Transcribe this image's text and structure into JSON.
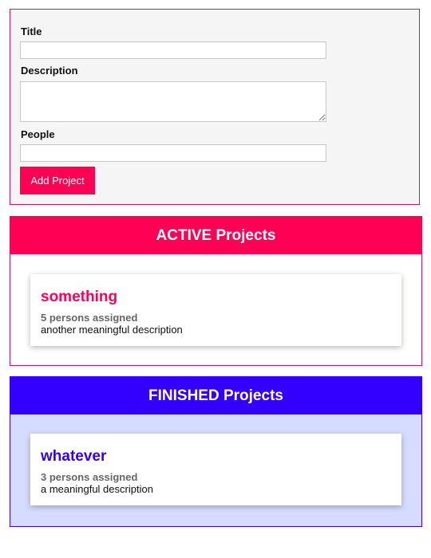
{
  "form": {
    "title_label": "Title",
    "title_value": "",
    "description_label": "Description",
    "description_value": "",
    "people_label": "People",
    "people_value": "",
    "submit_label": "Add Project"
  },
  "active": {
    "heading": "ACTIVE Projects",
    "color": "#ff0055",
    "projects": [
      {
        "title": "something",
        "people": "5 persons assigned",
        "description": "another meaningful description"
      }
    ]
  },
  "finished": {
    "heading": "FINISHED Projects",
    "color": "#3300ff",
    "background": "#d6dcff",
    "projects": [
      {
        "title": "whatever",
        "people": "3 persons assigned",
        "description": "a meaningful description"
      }
    ]
  }
}
